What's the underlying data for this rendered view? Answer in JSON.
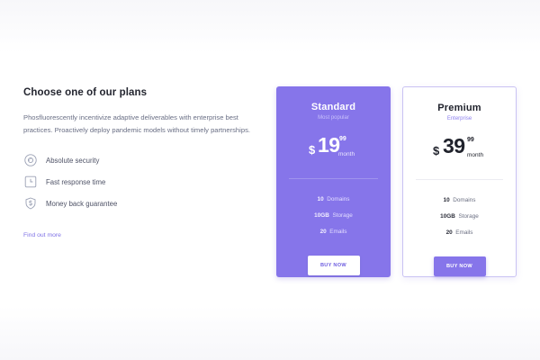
{
  "info": {
    "title": "Choose one of our plans",
    "description": "Phosfluorescently incentivize adaptive deliverables with enterprise best practices. Proactively deploy pandemic models without timely partnerships.",
    "features": [
      {
        "label": "Absolute security",
        "icon": "shield-lock-icon"
      },
      {
        "label": "Fast response time",
        "icon": "clock-icon"
      },
      {
        "label": "Money back guarantee",
        "icon": "dollar-shield-icon"
      }
    ],
    "find_more": "Find out more"
  },
  "plans": [
    {
      "name": "Standard",
      "subtitle": "Most popular",
      "currency": "$",
      "price": "19",
      "cents": "99",
      "period": "month",
      "features": [
        {
          "value": "10",
          "label": "Domains"
        },
        {
          "value": "10GB",
          "label": "Storage"
        },
        {
          "value": "20",
          "label": "Emails"
        }
      ],
      "button": "BUY NOW"
    },
    {
      "name": "Premium",
      "subtitle": "Enterprise",
      "currency": "$",
      "price": "39",
      "cents": "99",
      "period": "month",
      "features": [
        {
          "value": "10",
          "label": "Domains"
        },
        {
          "value": "10GB",
          "label": "Storage"
        },
        {
          "value": "20",
          "label": "Emails"
        }
      ],
      "button": "BUY NOW"
    }
  ],
  "colors": {
    "accent": "#8675ea",
    "background": "#fbfbfd",
    "text_dark": "#23252f",
    "text_muted": "#6a6f85"
  }
}
